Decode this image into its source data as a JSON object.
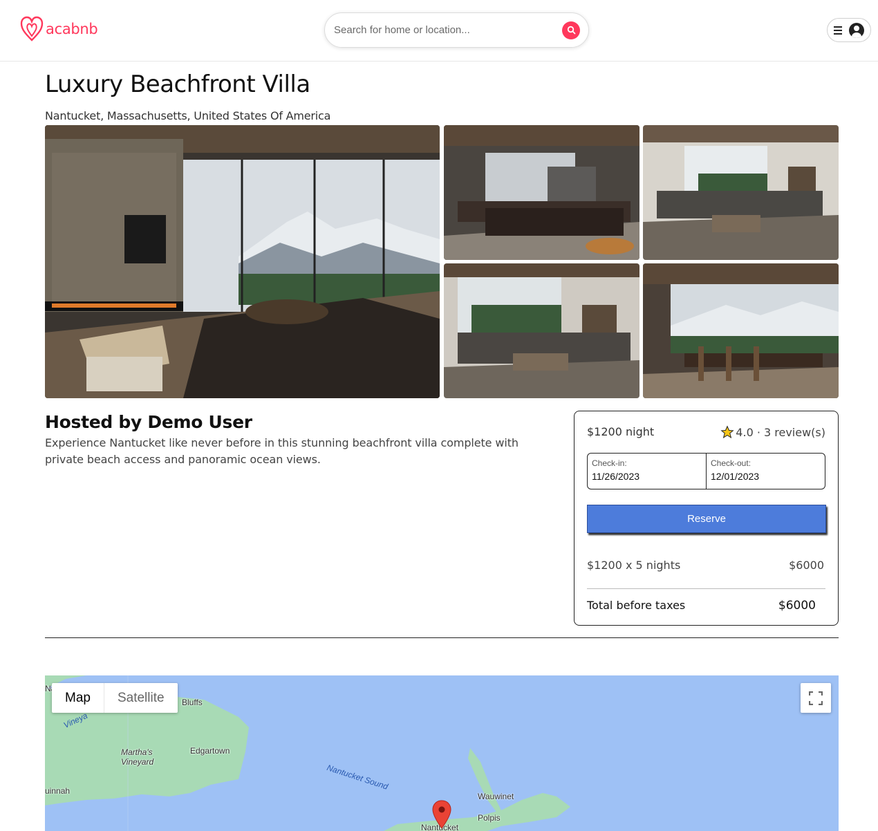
{
  "header": {
    "logo_text": "acabnb",
    "search_placeholder": "Search for home or location..."
  },
  "listing": {
    "title": "Luxury Beachfront Villa",
    "location": "Nantucket, Massachusetts, United States Of America",
    "host": "Hosted by Demo User",
    "description": "Experience Nantucket like never before in this stunning beachfront villa complete with private beach access and panoramic ocean views."
  },
  "booking": {
    "price_per_night": "$1200 night",
    "rating": "4.0 · 3 review(s)",
    "checkin_label": "Check-in:",
    "checkin_value": "11/26/2023",
    "checkout_label": "Check-out:",
    "checkout_value": "12/01/2023",
    "reserve_label": "Reserve",
    "calc_label": "$1200 x 5 nights",
    "calc_value": "$6000",
    "total_label": "Total before taxes",
    "total_value": "$6000"
  },
  "map": {
    "map_tab": "Map",
    "satellite_tab": "Satellite",
    "places": {
      "bluffs": "Bluffs",
      "marthas_vineyard": "Martha's\nVineyard",
      "edgartown": "Edgartown",
      "nantucket_sound": "Nantucket Sound",
      "wauwinet": "Wauwinet",
      "polpis": "Polpis",
      "nantucket": "Nantucket",
      "uinnah": "uinnah",
      "vineyard": "Vineya",
      "na": "Na"
    }
  },
  "colors": {
    "brand": "#ff385c",
    "reserve": "#4d7cdb",
    "water": "#9ec1f5",
    "land": "#a8dab5",
    "pin": "#ea4335"
  }
}
